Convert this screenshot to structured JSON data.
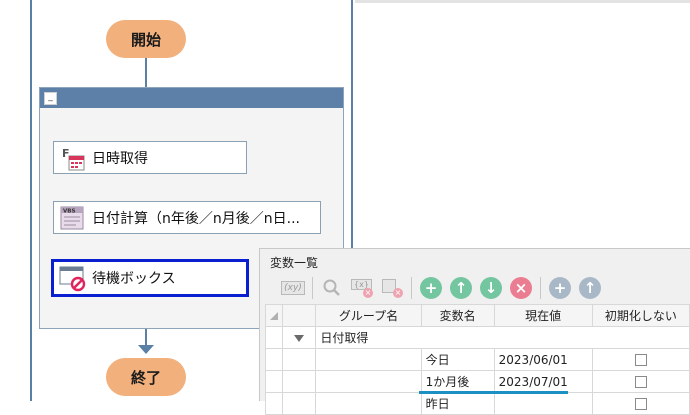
{
  "flow": {
    "start_label": "開始",
    "end_label": "終了",
    "actions": [
      {
        "label": "日時取得",
        "icon": "calendar-function-icon"
      },
      {
        "label": "日付計算（n年後／n月後／n日...",
        "icon": "vbs-script-icon"
      },
      {
        "label": "待機ボックス",
        "icon": "wait-dialog-icon"
      }
    ],
    "group_collapse": "_"
  },
  "var_panel": {
    "title": "変数一覧",
    "toolbar": {
      "xy_label": "(xy)",
      "x_label": "{x}"
    },
    "columns": [
      "グループ名",
      "変数名",
      "現在値",
      "初期化しない"
    ],
    "group_row": {
      "name": "日付取得"
    },
    "rows": [
      {
        "name": "今日",
        "value": "2023/06/01"
      },
      {
        "name": "1か月後",
        "value": "2023/07/01"
      },
      {
        "name": "昨日",
        "value": ""
      }
    ]
  },
  "colors": {
    "terminal": "#f2b07c",
    "lane": "#5b80a6",
    "selected_border": "#0a1fd0",
    "add_green": "#6cc49a",
    "delete_red": "#e7738a"
  }
}
